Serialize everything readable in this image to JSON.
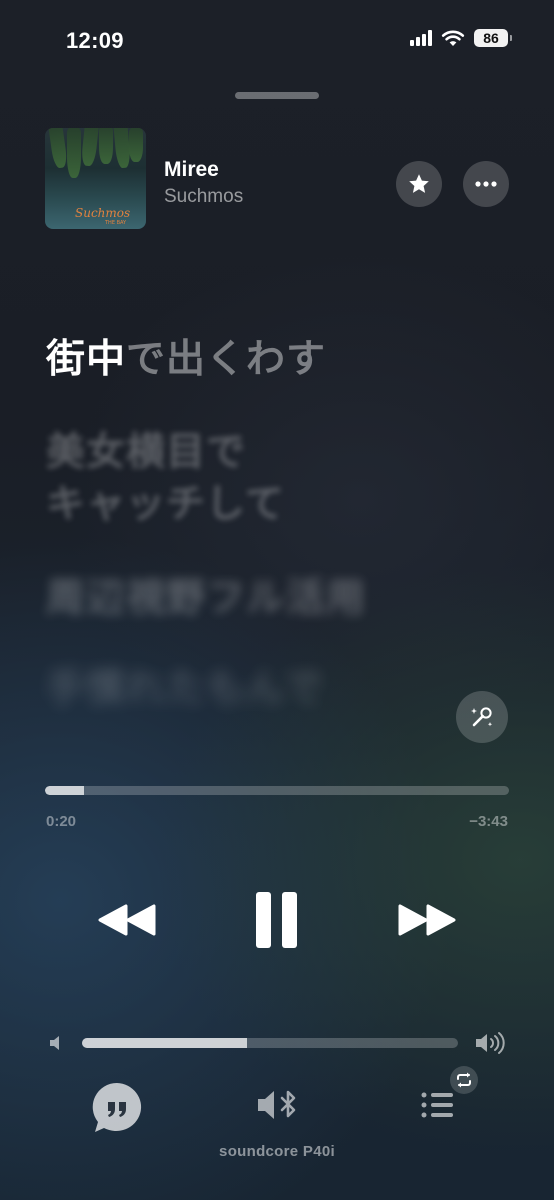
{
  "status_bar": {
    "time": "12:09",
    "battery_level": "86"
  },
  "now_playing": {
    "artwork_text": "Suchmos",
    "artwork_subtext": "THE BAY",
    "title": "Miree",
    "artist": "Suchmos"
  },
  "lyrics": {
    "active_sung": "街中",
    "active_unsung": "で出くわす",
    "upcoming": [
      "美女横目で",
      "キャッチして",
      "周辺視野フル活用",
      "手慣れたもんで"
    ]
  },
  "playback": {
    "progress_fraction": 0.083,
    "elapsed": "0:20",
    "remaining": "−3:43",
    "state": "playing",
    "volume_fraction": 0.44
  },
  "output_device": {
    "name": "soundcore P40i"
  },
  "icons": {
    "favorite": "star-icon",
    "more": "ellipsis-icon",
    "sing": "microphone-sparkle-icon",
    "rewind": "rewind-icon",
    "pause": "pause-icon",
    "forward": "fast-forward-icon",
    "volume_low": "speaker-low-icon",
    "volume_high": "speaker-high-icon",
    "lyrics": "quote-bubble-icon",
    "airplay": "speaker-bluetooth-icon",
    "queue": "list-icon",
    "repeat": "repeat-icon"
  },
  "colors": {
    "artwork_accent": "#e2823f"
  }
}
